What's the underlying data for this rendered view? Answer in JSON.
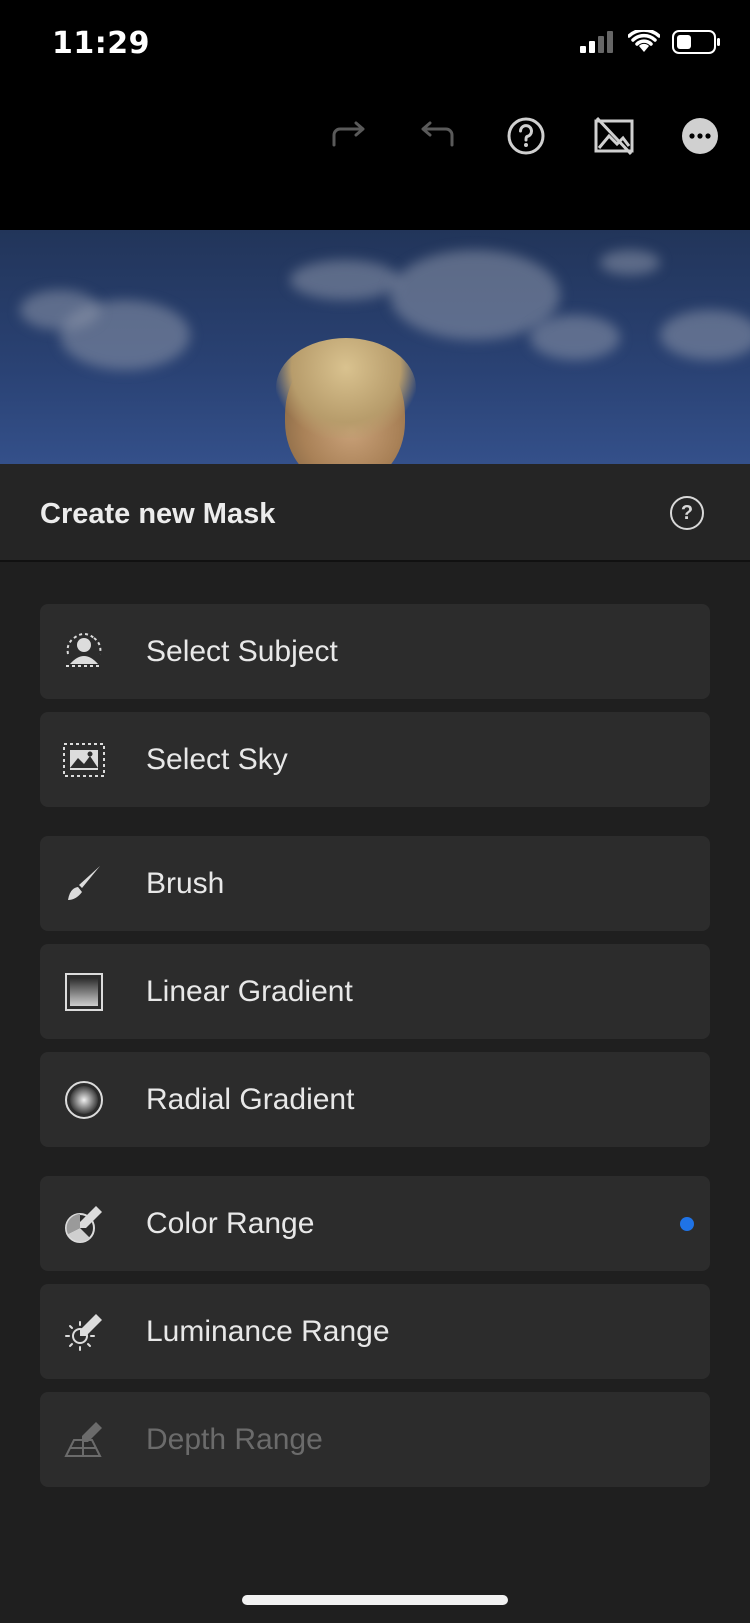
{
  "status_bar": {
    "time": "11:29"
  },
  "toolbar": {
    "icons": [
      "redo-icon",
      "undo-icon",
      "help-icon",
      "show-original-icon",
      "more-icon"
    ]
  },
  "panel": {
    "title": "Create new Mask",
    "help_icon_glyph": "?",
    "options": [
      {
        "label": "Select Subject",
        "icon": "select-subject-icon",
        "enabled": true,
        "badge": false
      },
      {
        "label": "Select Sky",
        "icon": "select-sky-icon",
        "enabled": true,
        "badge": false
      },
      {
        "label": "Brush",
        "icon": "brush-icon",
        "enabled": true,
        "badge": false
      },
      {
        "label": "Linear Gradient",
        "icon": "linear-gradient-icon",
        "enabled": true,
        "badge": false
      },
      {
        "label": "Radial Gradient",
        "icon": "radial-gradient-icon",
        "enabled": true,
        "badge": false
      },
      {
        "label": "Color Range",
        "icon": "color-range-icon",
        "enabled": true,
        "badge": true
      },
      {
        "label": "Luminance Range",
        "icon": "luminance-range-icon",
        "enabled": true,
        "badge": false
      },
      {
        "label": "Depth Range",
        "icon": "depth-range-icon",
        "enabled": false,
        "badge": false
      }
    ]
  },
  "colors": {
    "accent_dot": "#1f73e6",
    "panel_bg": "#1f1f1f",
    "option_bg": "#2c2c2c"
  }
}
